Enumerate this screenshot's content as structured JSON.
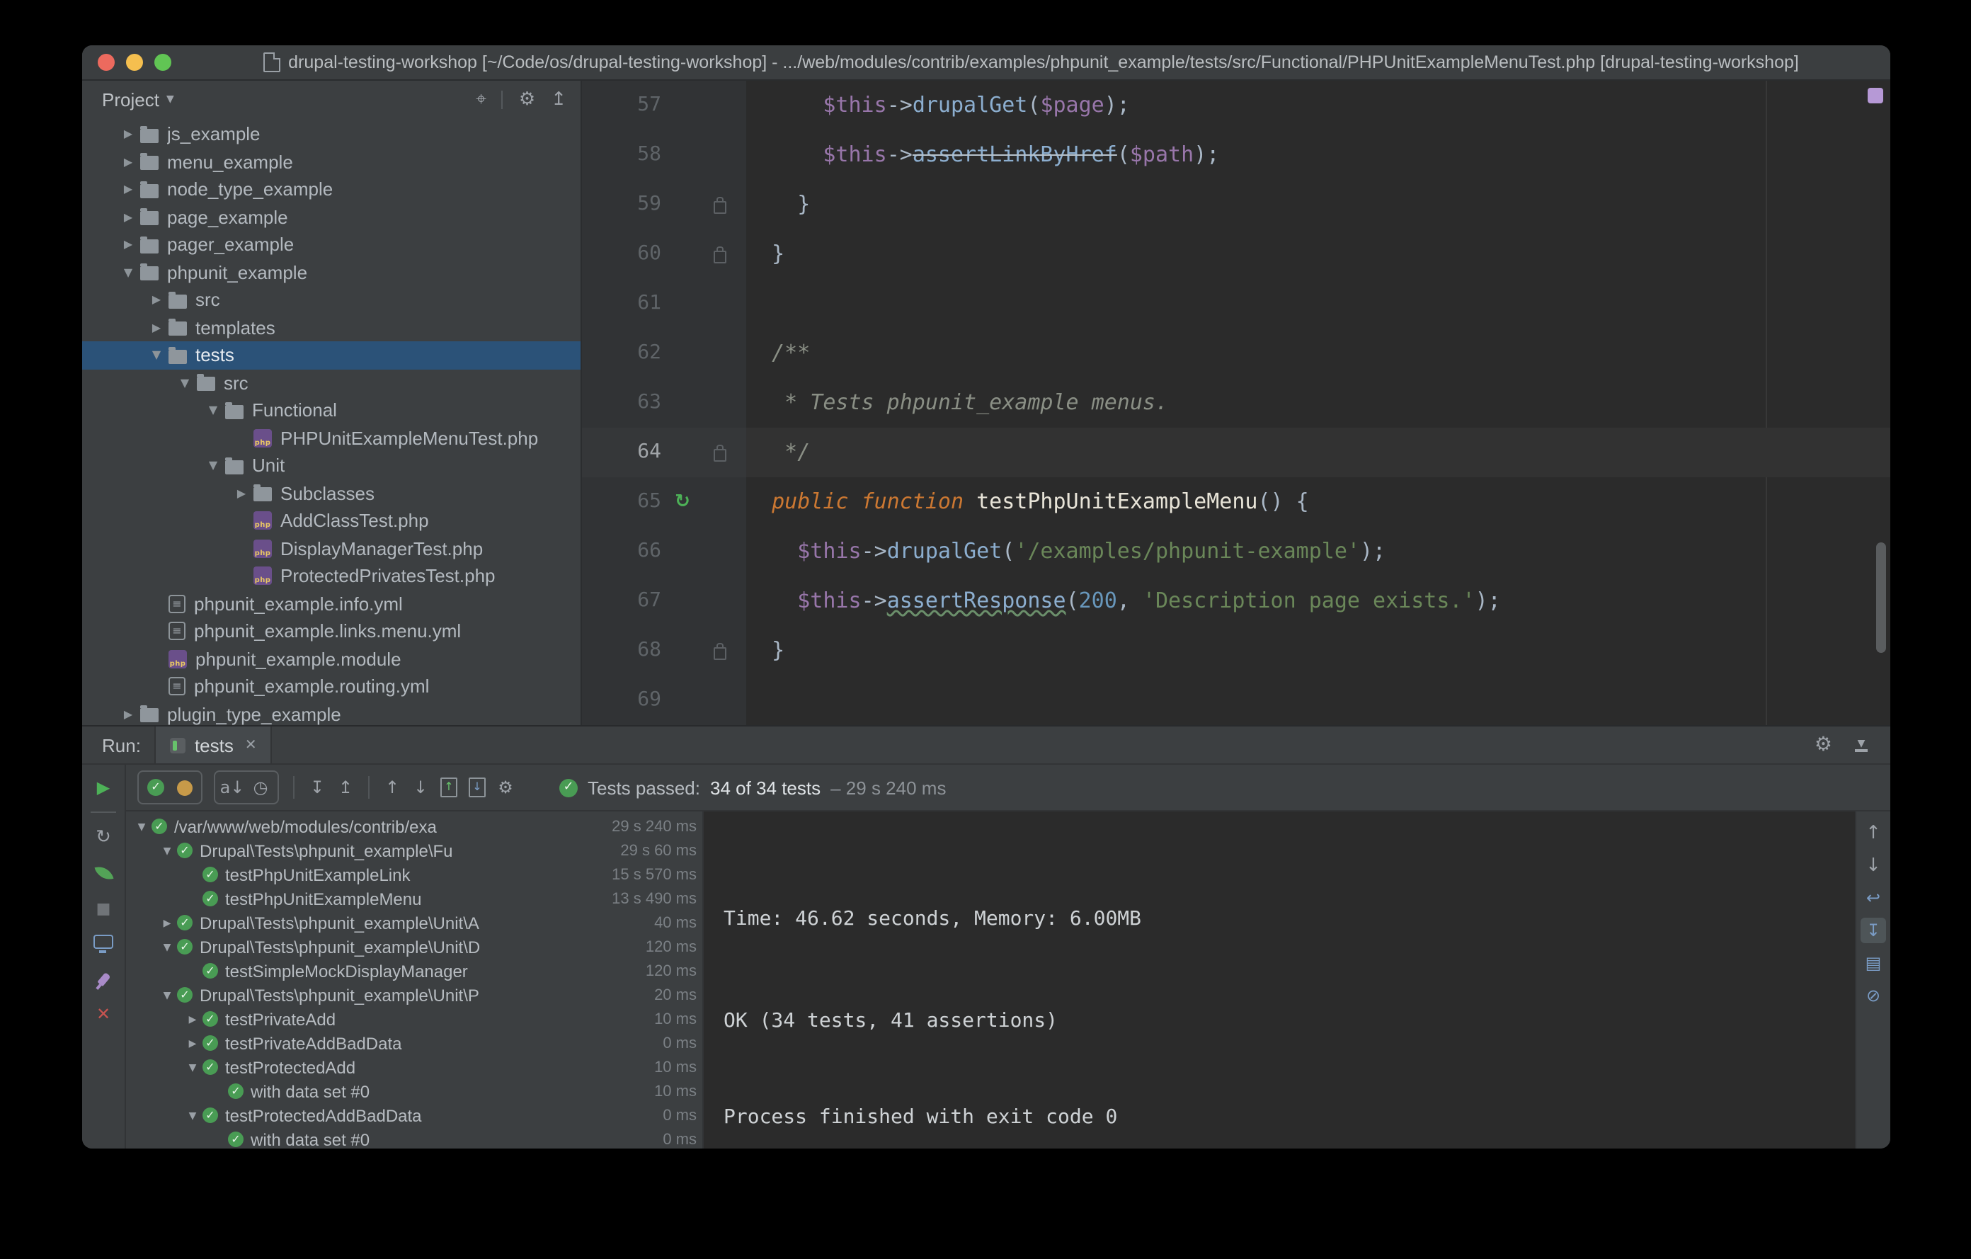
{
  "window": {
    "title": "drupal-testing-workshop [~/Code/os/drupal-testing-workshop] - .../web/modules/contrib/examples/phpunit_example/tests/src/Functional/PHPUnitExampleMenuTest.php [drupal-testing-workshop]"
  },
  "colors": {
    "selection_blue": "#2b5278",
    "pass_green": "#499c54",
    "panel_bg": "#3c3f41",
    "editor_bg": "#2b2b2b",
    "close_red": "#c75450"
  },
  "icons": {
    "run": "▶",
    "check": "✓",
    "close": "✕",
    "caret_down": "▼",
    "gear": "⚙",
    "locate": "⌖",
    "collapse_all": "↥",
    "expand_all": "↧",
    "up": "↑",
    "down": "↓",
    "sort_az": "a↓",
    "sort_time": "◷"
  },
  "project_panel": {
    "header_label": "Project",
    "items": [
      {
        "label": "js_example",
        "indent": 1,
        "icon": "folder",
        "arrow": "right"
      },
      {
        "label": "menu_example",
        "indent": 1,
        "icon": "folder",
        "arrow": "right"
      },
      {
        "label": "node_type_example",
        "indent": 1,
        "icon": "folder",
        "arrow": "right"
      },
      {
        "label": "page_example",
        "indent": 1,
        "icon": "folder",
        "arrow": "right"
      },
      {
        "label": "pager_example",
        "indent": 1,
        "icon": "folder",
        "arrow": "right"
      },
      {
        "label": "phpunit_example",
        "indent": 1,
        "icon": "folder",
        "arrow": "down"
      },
      {
        "label": "src",
        "indent": 2,
        "icon": "folder",
        "arrow": "right"
      },
      {
        "label": "templates",
        "indent": 2,
        "icon": "folder",
        "arrow": "right"
      },
      {
        "label": "tests",
        "indent": 2,
        "icon": "folder",
        "arrow": "down",
        "selected": true
      },
      {
        "label": "src",
        "indent": 3,
        "icon": "folder",
        "arrow": "down"
      },
      {
        "label": "Functional",
        "indent": 4,
        "icon": "folder",
        "arrow": "down"
      },
      {
        "label": "PHPUnitExampleMenuTest.php",
        "indent": 5,
        "icon": "php"
      },
      {
        "label": "Unit",
        "indent": 4,
        "icon": "folder",
        "arrow": "down"
      },
      {
        "label": "Subclasses",
        "indent": 5,
        "icon": "folder",
        "arrow": "right"
      },
      {
        "label": "AddClassTest.php",
        "indent": 5,
        "icon": "php"
      },
      {
        "label": "DisplayManagerTest.php",
        "indent": 5,
        "icon": "php"
      },
      {
        "label": "ProtectedPrivatesTest.php",
        "indent": 5,
        "icon": "php"
      },
      {
        "label": "phpunit_example.info.yml",
        "indent": 2,
        "icon": "yml"
      },
      {
        "label": "phpunit_example.links.menu.yml",
        "indent": 2,
        "icon": "yml"
      },
      {
        "label": "phpunit_example.module",
        "indent": 2,
        "icon": "php"
      },
      {
        "label": "phpunit_example.routing.yml",
        "indent": 2,
        "icon": "yml"
      },
      {
        "label": "plugin_type_example",
        "indent": 1,
        "icon": "folder",
        "arrow": "right"
      }
    ]
  },
  "editor": {
    "lines": [
      {
        "n": 57,
        "tokens": [
          [
            "txt",
            "      "
          ],
          [
            "var",
            "$this"
          ],
          [
            "txt",
            "->"
          ],
          [
            "fn",
            "drupalGet"
          ],
          [
            "txt",
            "("
          ],
          [
            "var",
            "$page"
          ],
          [
            "txt",
            ");"
          ]
        ]
      },
      {
        "n": 58,
        "tokens": [
          [
            "txt",
            "      "
          ],
          [
            "var",
            "$this"
          ],
          [
            "txt",
            "->"
          ],
          [
            "fndep",
            "assertLinkByHref"
          ],
          [
            "txt",
            "("
          ],
          [
            "var",
            "$path"
          ],
          [
            "txt",
            ");"
          ]
        ]
      },
      {
        "n": 59,
        "g": "fold",
        "tokens": [
          [
            "txt",
            "    }"
          ]
        ]
      },
      {
        "n": 60,
        "g": "fold",
        "tokens": [
          [
            "txt",
            "  }"
          ]
        ]
      },
      {
        "n": 61,
        "tokens": []
      },
      {
        "n": 62,
        "tokens": [
          [
            "cmt",
            "  /**"
          ]
        ]
      },
      {
        "n": 63,
        "tokens": [
          [
            "cmt",
            "   * Tests phpunit_example menus."
          ]
        ]
      },
      {
        "n": 64,
        "g": "fold",
        "cur": true,
        "tokens": [
          [
            "cmt",
            "   */"
          ]
        ]
      },
      {
        "n": 65,
        "g": "run",
        "tokens": [
          [
            "txt",
            "  "
          ],
          [
            "kw",
            "public"
          ],
          [
            "txt",
            " "
          ],
          [
            "kw",
            "function"
          ],
          [
            "txt",
            " "
          ],
          [
            "decl",
            "testPhpUnitExampleMenu"
          ],
          [
            "txt",
            "() {"
          ]
        ]
      },
      {
        "n": 66,
        "tokens": [
          [
            "txt",
            "    "
          ],
          [
            "var",
            "$this"
          ],
          [
            "txt",
            "->"
          ],
          [
            "fn",
            "drupalGet"
          ],
          [
            "txt",
            "("
          ],
          [
            "str",
            "'/examples/phpunit-example'"
          ],
          [
            "txt",
            ");"
          ]
        ]
      },
      {
        "n": 67,
        "tokens": [
          [
            "txt",
            "    "
          ],
          [
            "var",
            "$this"
          ],
          [
            "txt",
            "->"
          ],
          [
            "fnwarn",
            "assertResponse"
          ],
          [
            "txt",
            "("
          ],
          [
            "num",
            "200"
          ],
          [
            "txt",
            ", "
          ],
          [
            "str",
            "'Description page exists.'"
          ],
          [
            "txt",
            ");"
          ]
        ]
      },
      {
        "n": 68,
        "g": "fold",
        "tokens": [
          [
            "txt",
            "  }"
          ]
        ]
      },
      {
        "n": 69,
        "tokens": []
      }
    ]
  },
  "run_panel": {
    "run_label": "Run:",
    "tab_label": "tests",
    "status": {
      "prefix": "Tests passed:",
      "count": "34 of 34 tests",
      "duration": "– 29 s 240 ms"
    },
    "left_strip_icons": [
      "rerun-icon",
      "auto-test-icon",
      "stop-icon",
      "show-console-icon",
      "pin-icon",
      "close-icon"
    ],
    "right_strip_icons": [
      {
        "name": "scroll-up-icon"
      },
      {
        "name": "scroll-down-icon"
      },
      {
        "name": "soft-wrap-icon"
      },
      {
        "name": "scroll-to-end-icon",
        "selected": true
      },
      {
        "name": "print-icon"
      },
      {
        "name": "clear-all-icon"
      }
    ],
    "tree": [
      {
        "indent": 0,
        "arrow": "down",
        "label": "/var/www/web/modules/contrib/exa",
        "time": "29 s 240 ms"
      },
      {
        "indent": 1,
        "arrow": "down",
        "label": "Drupal\\Tests\\phpunit_example\\Fu",
        "time": "29 s 60 ms"
      },
      {
        "indent": 2,
        "arrow": null,
        "label": "testPhpUnitExampleLink",
        "time": "15 s 570 ms"
      },
      {
        "indent": 2,
        "arrow": null,
        "label": "testPhpUnitExampleMenu",
        "time": "13 s 490 ms"
      },
      {
        "indent": 1,
        "arrow": "right",
        "label": "Drupal\\Tests\\phpunit_example\\Unit\\A",
        "time": "40 ms"
      },
      {
        "indent": 1,
        "arrow": "down",
        "label": "Drupal\\Tests\\phpunit_example\\Unit\\D",
        "time": "120 ms"
      },
      {
        "indent": 2,
        "arrow": null,
        "label": "testSimpleMockDisplayManager",
        "time": "120 ms"
      },
      {
        "indent": 1,
        "arrow": "down",
        "label": "Drupal\\Tests\\phpunit_example\\Unit\\P",
        "time": "20 ms"
      },
      {
        "indent": 2,
        "arrow": "right",
        "label": "testPrivateAdd",
        "time": "10 ms"
      },
      {
        "indent": 2,
        "arrow": "right",
        "label": "testPrivateAddBadData",
        "time": "0 ms"
      },
      {
        "indent": 2,
        "arrow": "down",
        "label": "testProtectedAdd",
        "time": "10 ms"
      },
      {
        "indent": 3,
        "arrow": null,
        "label": "with data set #0",
        "time": "10 ms"
      },
      {
        "indent": 2,
        "arrow": "down",
        "label": "testProtectedAddBadData",
        "time": "0 ms"
      },
      {
        "indent": 3,
        "arrow": null,
        "label": "with data set #0",
        "time": "0 ms"
      }
    ],
    "console_lines": [
      "Time: 46.62 seconds, Memory: 6.00MB",
      "OK (34 tests, 41 assertions)",
      "Process finished with exit code 0"
    ]
  }
}
